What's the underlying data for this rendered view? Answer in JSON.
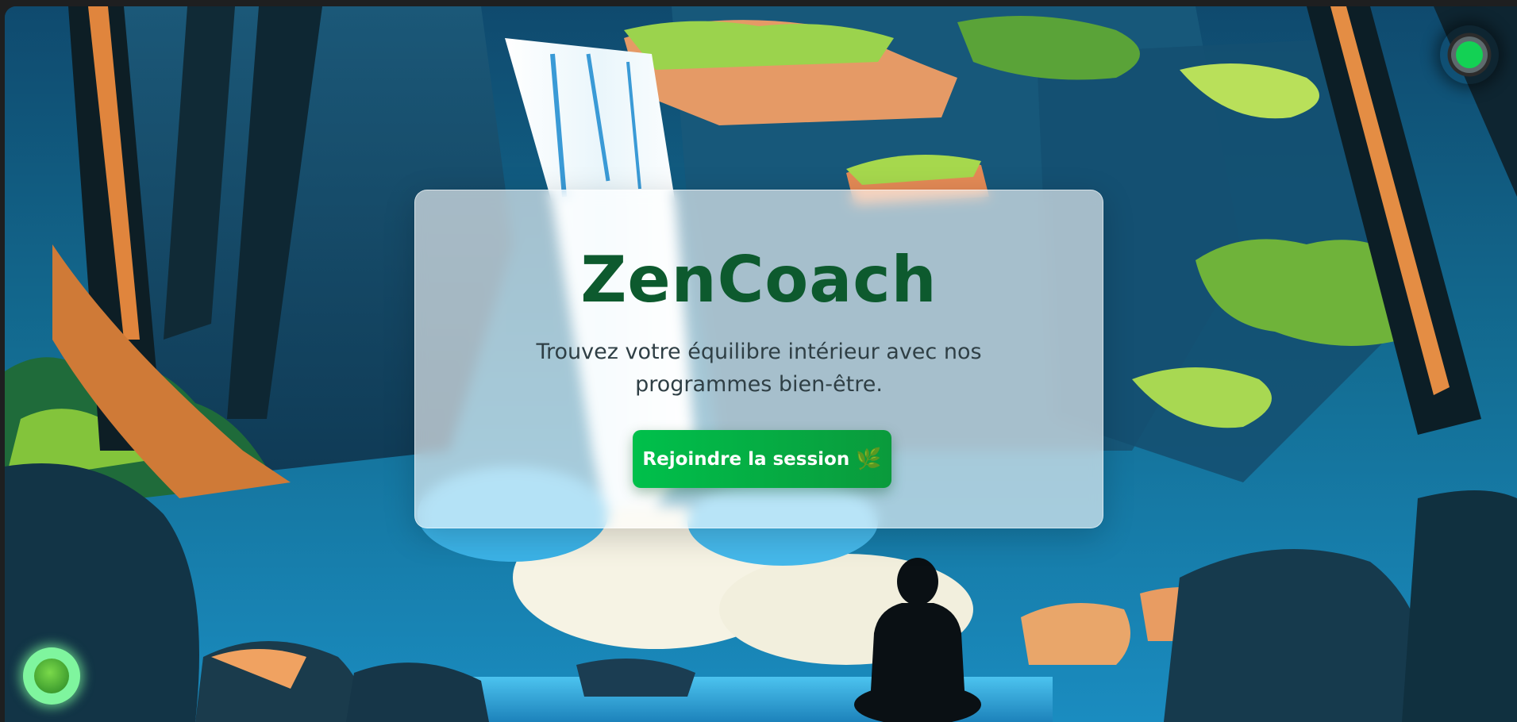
{
  "hero": {
    "title": "ZenCoach",
    "tagline": "Trouvez votre équilibre intérieur avec nos programmes bien-être.",
    "join_button_label": "Rejoindre la session",
    "join_button_icon": "🌿"
  },
  "colors": {
    "title": "#0d5a2e",
    "button_start": "#00c04b",
    "button_end": "#0a9a3c",
    "status_dot": "#13d154",
    "orb": "#7ff59e"
  },
  "icons": {
    "status": "status-indicator-icon",
    "orb": "assistant-orb-icon",
    "leaf": "leaf-icon"
  }
}
